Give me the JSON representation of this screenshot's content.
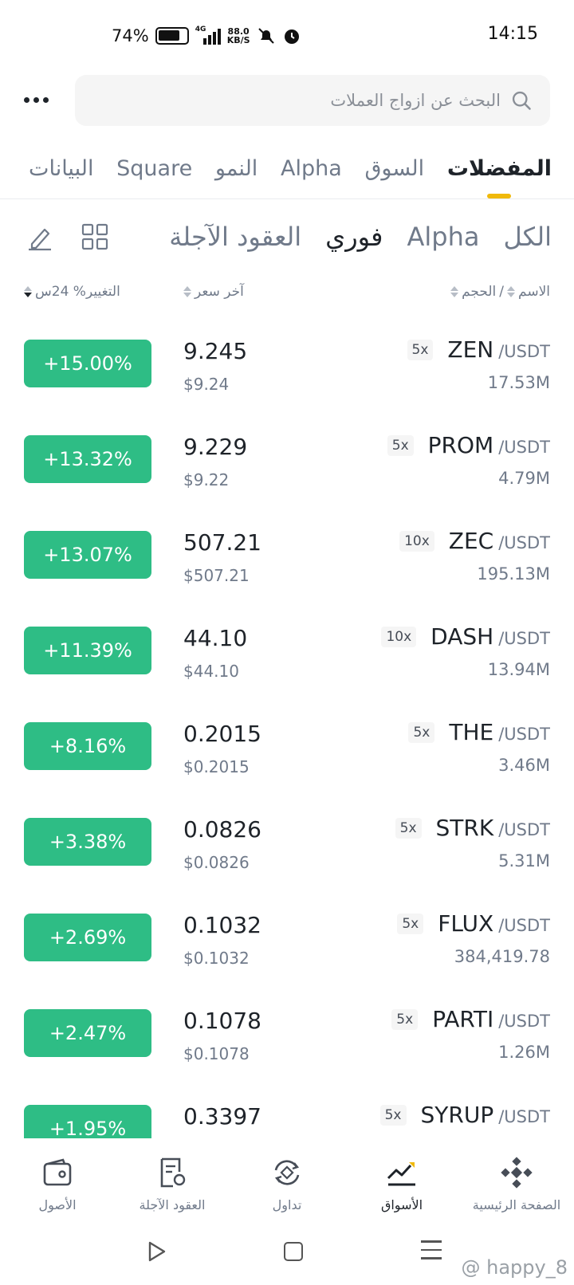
{
  "status_bar": {
    "battery": "74%",
    "network_type": "4G",
    "net_speed_value": "88.0",
    "net_speed_unit": "KB/S",
    "time": "14:15"
  },
  "search": {
    "placeholder": "البحث عن ازواج العملات"
  },
  "top_tabs": [
    {
      "label": "المفضلات",
      "active": true
    },
    {
      "label": "السوق",
      "active": false
    },
    {
      "label": "Alpha",
      "active": false
    },
    {
      "label": "النمو",
      "active": false
    },
    {
      "label": "Square",
      "active": false
    },
    {
      "label": "البيانات",
      "active": false
    }
  ],
  "sub_tabs": [
    {
      "label": "الكل",
      "active": false
    },
    {
      "label": "Alpha",
      "active": false
    },
    {
      "label": "فوري",
      "active": true
    },
    {
      "label": "العقود الآجلة",
      "active": false
    }
  ],
  "columns": {
    "name": "الاسم",
    "separator": "/",
    "volume": "الحجم",
    "last_price": "آخر سعر",
    "change": "التغيير% 24س"
  },
  "rows": [
    {
      "base": "ZEN",
      "quote": "/USDT",
      "leverage": "5x",
      "volume": "17.53M",
      "price": "9.245",
      "price_usd": "$9.24",
      "change": "+15.00%"
    },
    {
      "base": "PROM",
      "quote": "/USDT",
      "leverage": "5x",
      "volume": "4.79M",
      "price": "9.229",
      "price_usd": "$9.22",
      "change": "+13.32%"
    },
    {
      "base": "ZEC",
      "quote": "/USDT",
      "leverage": "10x",
      "volume": "195.13M",
      "price": "507.21",
      "price_usd": "$507.21",
      "change": "+13.07%"
    },
    {
      "base": "DASH",
      "quote": "/USDT",
      "leverage": "10x",
      "volume": "13.94M",
      "price": "44.10",
      "price_usd": "$44.10",
      "change": "+11.39%"
    },
    {
      "base": "THE",
      "quote": "/USDT",
      "leverage": "5x",
      "volume": "3.46M",
      "price": "0.2015",
      "price_usd": "$0.2015",
      "change": "+8.16%"
    },
    {
      "base": "STRK",
      "quote": "/USDT",
      "leverage": "5x",
      "volume": "5.31M",
      "price": "0.0826",
      "price_usd": "$0.0826",
      "change": "+3.38%"
    },
    {
      "base": "FLUX",
      "quote": "/USDT",
      "leverage": "5x",
      "volume": "384,419.78",
      "price": "0.1032",
      "price_usd": "$0.1032",
      "change": "+2.69%"
    },
    {
      "base": "PARTI",
      "quote": "/USDT",
      "leverage": "5x",
      "volume": "1.26M",
      "price": "0.1078",
      "price_usd": "$0.1078",
      "change": "+2.47%"
    },
    {
      "base": "SYRUP",
      "quote": "/USDT",
      "leverage": "5x",
      "volume": "",
      "price": "0.3397",
      "price_usd": "",
      "change": "+1.95%"
    }
  ],
  "bottom_nav": [
    {
      "label": "الأصول",
      "icon": "wallet-icon",
      "active": false
    },
    {
      "label": "العقود الآجلة",
      "icon": "futures-icon",
      "active": false
    },
    {
      "label": "تداول",
      "icon": "trade-icon",
      "active": false
    },
    {
      "label": "الأسواق",
      "icon": "markets-icon",
      "active": true
    },
    {
      "label": "الصفحة الرئيسية",
      "icon": "home-icon",
      "active": false
    }
  ],
  "watermark": "@ happy_8",
  "colors": {
    "accent": "#f0b90b",
    "positive": "#2ebd85",
    "text": "#1e2329",
    "muted": "#707a8a"
  }
}
